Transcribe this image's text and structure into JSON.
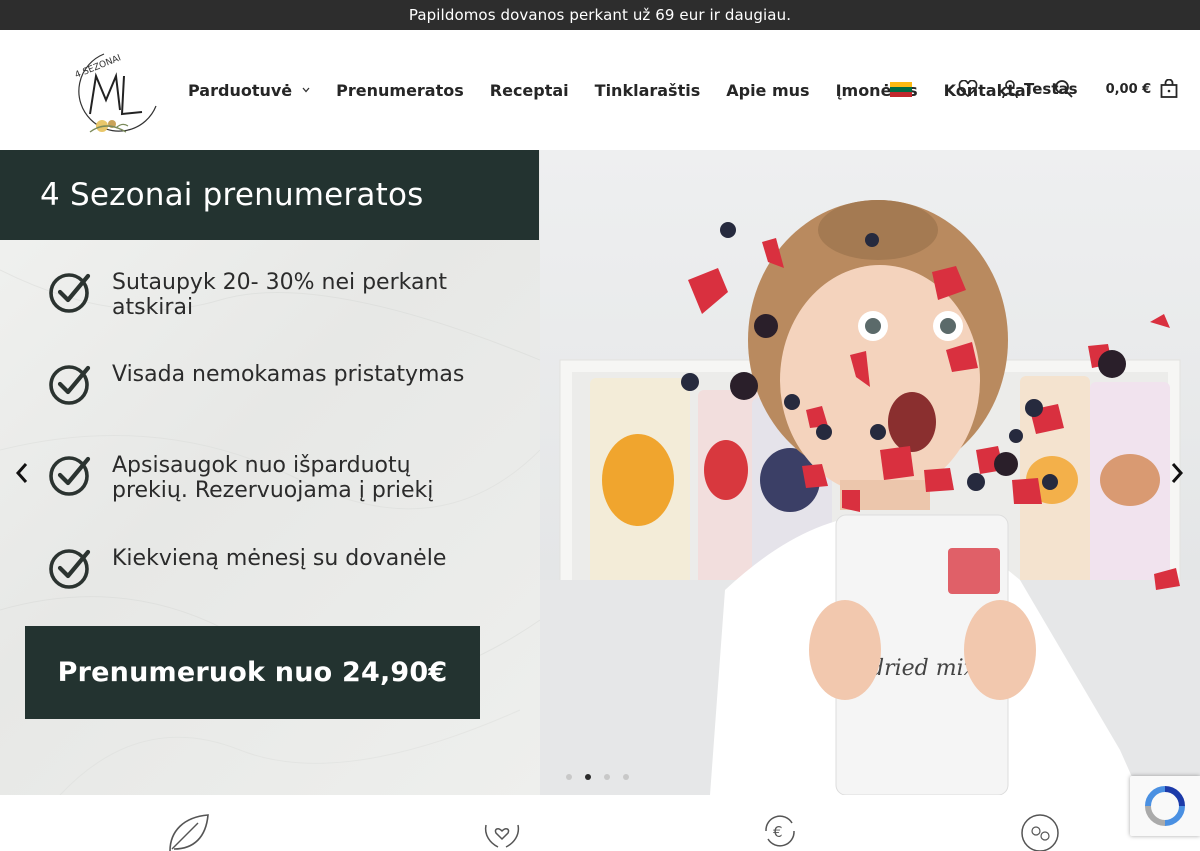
{
  "announcement": "Papildomos dovanos perkant už 69 eur ir daugiau.",
  "logo": {
    "text": "4 SEZONAI",
    "monogram": "ML"
  },
  "nav": {
    "items": [
      "Parduotuvė",
      "Prenumeratos",
      "Receptai",
      "Tinklaraštis",
      "Apie mus",
      "Įmonėms",
      "Kontaktai"
    ],
    "shop_dropdown_icon": "chevron-down-icon"
  },
  "header": {
    "language_flag": "lithuania-flag",
    "user_name": "Testas",
    "cart_total": "0,00 €",
    "icons": [
      "heart-icon",
      "user-icon",
      "search-icon",
      "bag-icon"
    ]
  },
  "hero": {
    "title": "4 Sezonai prenumeratos",
    "benefits": [
      "Sutaupyk 20- 30% nei perkant atskirai",
      "Visada nemokamas pristatymas",
      "Apsisaugok nuo išparduotų prekių. Rezervuojama į priekį",
      "Kiekvieną mėnesį su dovanėle"
    ],
    "cta_label": "Prenumeruok nuo 24,90€",
    "image": "girl-with-freeze-dried-berries-photo",
    "slides_count": 4,
    "active_slide": 2
  },
  "features": {
    "icons": [
      "leaf-icon",
      "hands-heart-icon",
      "euro-cycle-icon",
      "fruit-circle-icon"
    ]
  },
  "colors": {
    "dark_green": "#233330",
    "topbar": "#2d2d2d",
    "text": "#262626"
  }
}
